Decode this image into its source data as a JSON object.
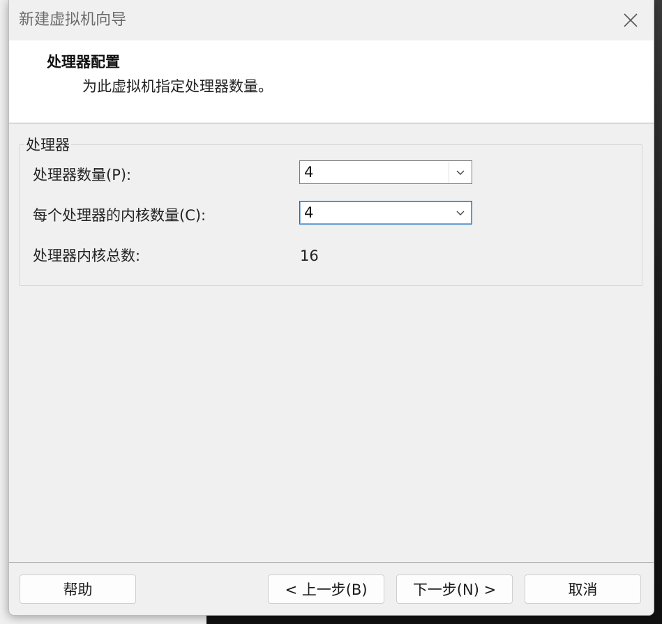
{
  "window": {
    "title": "新建虚拟机向导"
  },
  "header": {
    "title": "处理器配置",
    "subtitle": "为此虚拟机指定处理器数量。"
  },
  "processor_group": {
    "legend": "处理器",
    "processor_count": {
      "label": "处理器数量(P):",
      "value": "4"
    },
    "cores_per_processor": {
      "label": "每个处理器的内核数量(C):",
      "value": "4"
    },
    "total_cores": {
      "label": "处理器内核总数:",
      "value": "16"
    }
  },
  "buttons": {
    "help": "帮助",
    "back": "< 上一步(B)",
    "next": "下一步(N) >",
    "cancel": "取消"
  },
  "icons": {
    "close": "close-icon",
    "dropdown": "chevron-down-icon"
  },
  "colors": {
    "focus_border": "#0f6cbd"
  }
}
